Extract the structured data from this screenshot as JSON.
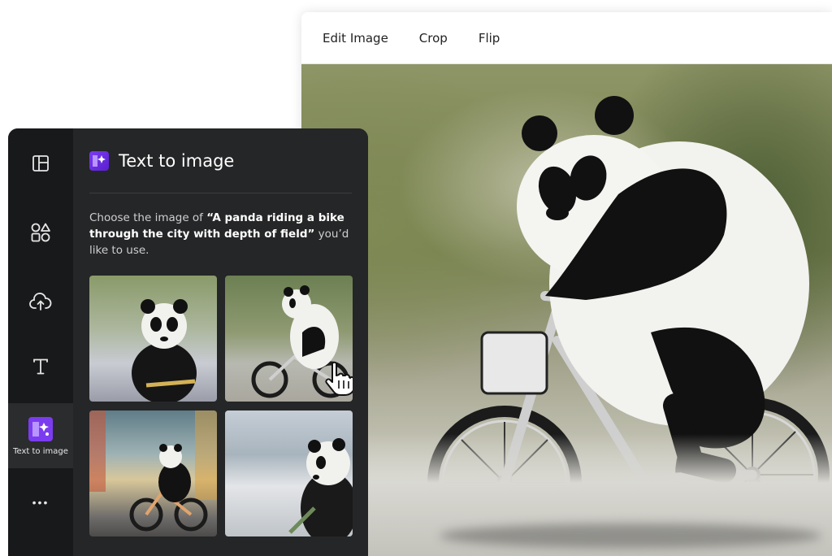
{
  "toolbar": {
    "edit_image_label": "Edit Image",
    "crop_label": "Crop",
    "flip_label": "Flip"
  },
  "panel": {
    "title": "Text to image",
    "description_prefix": "Choose the image of ",
    "prompt": "“A panda riding a bike through the city with depth of field”",
    "description_suffix": " you’d like to use.",
    "active_tool_label": "Text to image",
    "more_label": "•••",
    "rail_icons": [
      "layout-icon",
      "elements-icon",
      "upload-icon",
      "text-icon",
      "text-to-image-icon",
      "more-icon"
    ],
    "thumbnails": [
      {
        "name": "image-option-1"
      },
      {
        "name": "image-option-2"
      },
      {
        "name": "image-option-3"
      },
      {
        "name": "image-option-4"
      }
    ]
  },
  "colors": {
    "panel_bg": "#252627",
    "rail_bg": "#18191b",
    "accent": "#7b3cf0"
  }
}
